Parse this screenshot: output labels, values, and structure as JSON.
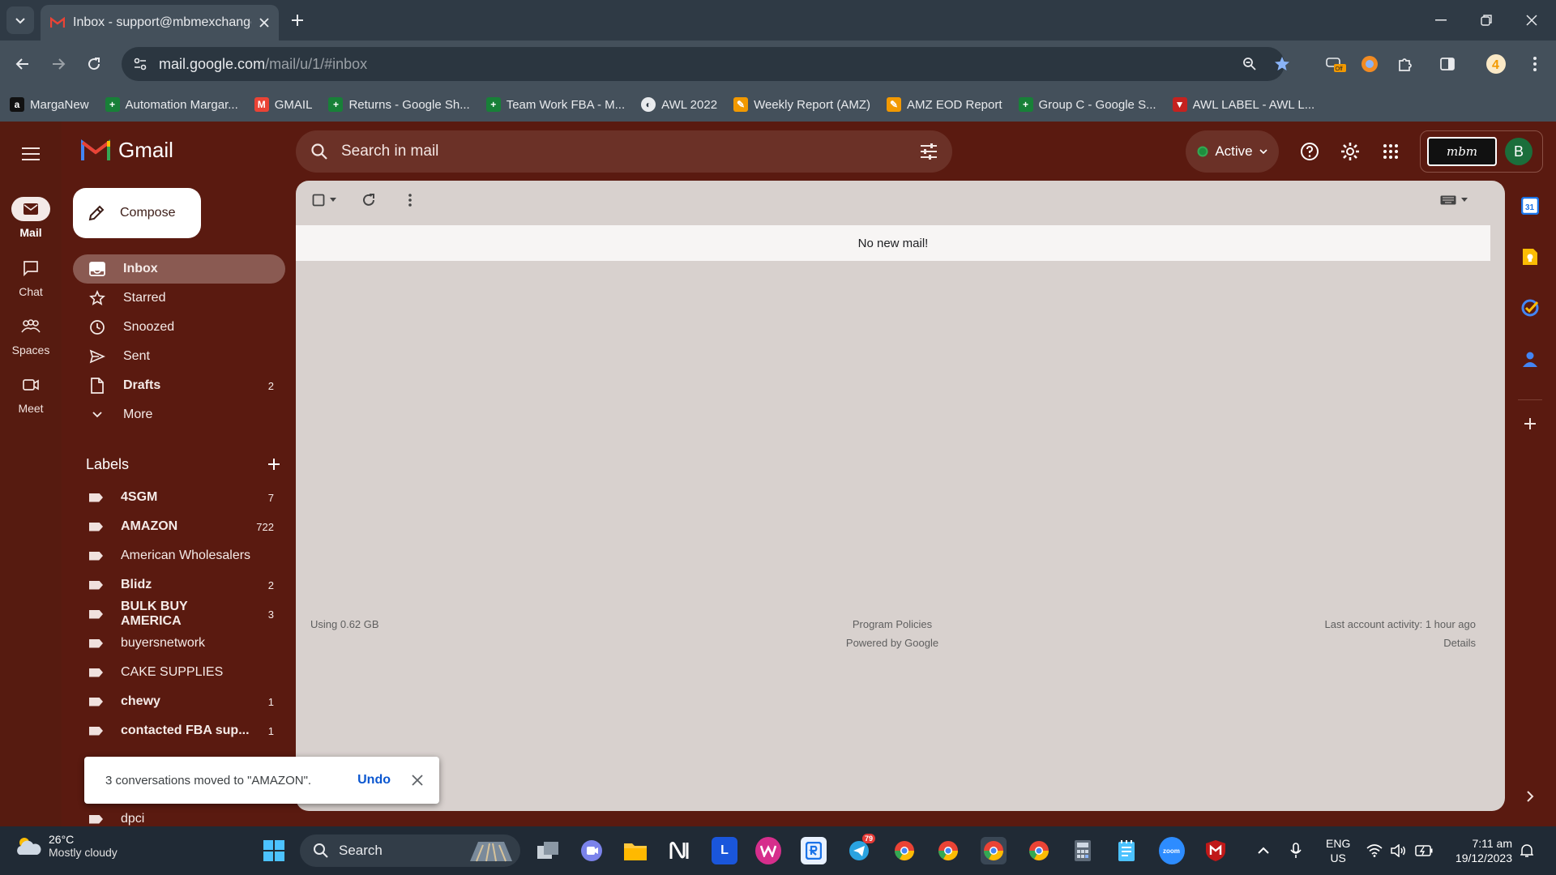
{
  "browser": {
    "tab_title": "Inbox - support@mbmexchange...",
    "url_host": "mail.google.com",
    "url_path": "/mail/u/1/#inbox",
    "bookmarks": [
      {
        "label": "MargaNew",
        "color": "#111111",
        "glyph": "a"
      },
      {
        "label": "Automation Margar...",
        "color": "#188038",
        "glyph": "+"
      },
      {
        "label": "GMAIL",
        "color": "#ea4335",
        "glyph": "M"
      },
      {
        "label": "Returns - Google Sh...",
        "color": "#188038",
        "glyph": "+"
      },
      {
        "label": "Team Work FBA - M...",
        "color": "#188038",
        "glyph": "+"
      },
      {
        "label": "AWL 2022",
        "color": "#e8eaed",
        "glyph": "◐"
      },
      {
        "label": "Weekly Report (AMZ)",
        "color": "#f29900",
        "glyph": "✎"
      },
      {
        "label": "AMZ EOD Report",
        "color": "#f29900",
        "glyph": "✎"
      },
      {
        "label": "Group C - Google S...",
        "color": "#188038",
        "glyph": "+"
      },
      {
        "label": "AWL LABEL - AWL L...",
        "color": "#c5221f",
        "glyph": "▼"
      }
    ]
  },
  "rail": {
    "mail": "Mail",
    "chat": "Chat",
    "spaces": "Spaces",
    "meet": "Meet"
  },
  "header": {
    "app_name": "Gmail",
    "search_placeholder": "Search in mail",
    "status": "Active",
    "avatar_letter": "B",
    "org_logo_text": "mbm"
  },
  "compose_label": "Compose",
  "nav": [
    {
      "label": "Inbox",
      "count": "",
      "selected": true,
      "bold": true,
      "icon": "inbox-icon"
    },
    {
      "label": "Starred",
      "count": "",
      "selected": false,
      "bold": false,
      "icon": "star-icon"
    },
    {
      "label": "Snoozed",
      "count": "",
      "selected": false,
      "bold": false,
      "icon": "clock-icon"
    },
    {
      "label": "Sent",
      "count": "",
      "selected": false,
      "bold": false,
      "icon": "send-icon"
    },
    {
      "label": "Drafts",
      "count": "2",
      "selected": false,
      "bold": true,
      "icon": "draft-icon"
    },
    {
      "label": "More",
      "count": "",
      "selected": false,
      "bold": false,
      "icon": "chevron-down-icon"
    }
  ],
  "labels_title": "Labels",
  "labels": [
    {
      "name": "4SGM",
      "count": "7",
      "bold": true
    },
    {
      "name": "AMAZON",
      "count": "722",
      "bold": true
    },
    {
      "name": "American Wholesalers",
      "count": "",
      "bold": false
    },
    {
      "name": "Blidz",
      "count": "2",
      "bold": true
    },
    {
      "name": "BULK BUY AMERICA",
      "count": "3",
      "bold": true
    },
    {
      "name": "buyersnetwork",
      "count": "",
      "bold": false
    },
    {
      "name": "CAKE SUPPLIES",
      "count": "",
      "bold": false
    },
    {
      "name": "chewy",
      "count": "1",
      "bold": true
    },
    {
      "name": "contacted FBA sup...",
      "count": "1",
      "bold": true
    },
    {
      "name": "dpci",
      "count": "",
      "bold": false
    }
  ],
  "main": {
    "empty_message": "No new mail!",
    "storage": "Using 0.62 GB",
    "program_policies": "Program Policies",
    "powered_by": "Powered by Google",
    "last_activity": "Last account activity: 1 hour ago",
    "details": "Details"
  },
  "snackbar": {
    "message": "3 conversations moved to \"AMAZON\".",
    "action": "Undo"
  },
  "taskbar": {
    "temperature": "26°C",
    "weather": "Mostly cloudy",
    "search": "Search",
    "lang1": "ENG",
    "lang2": "US",
    "time": "7:11 am",
    "date": "19/12/2023",
    "badges": {
      "telegram": "79"
    }
  }
}
